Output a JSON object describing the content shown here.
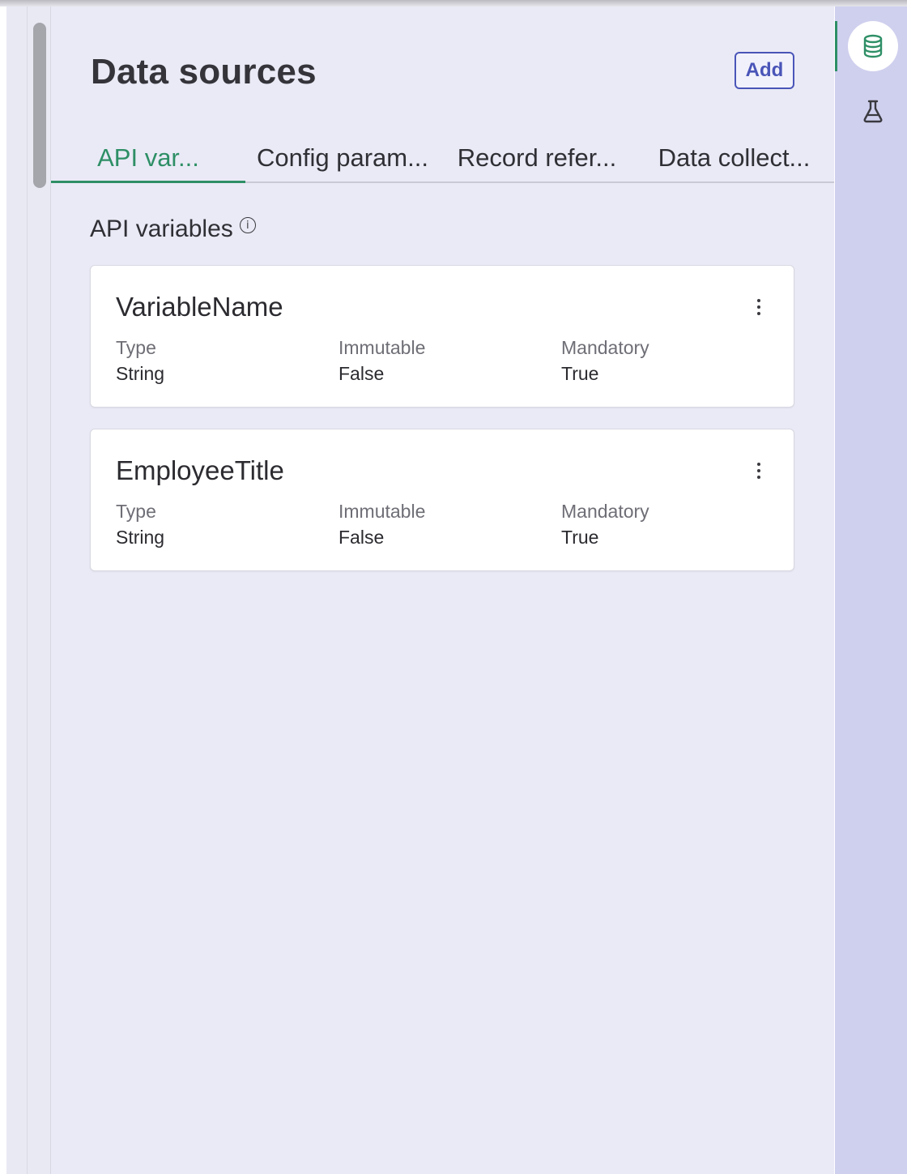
{
  "panel": {
    "title": "Data sources",
    "add_label": "Add"
  },
  "tabs": [
    {
      "label": "API var...",
      "active": true
    },
    {
      "label": "Config param...",
      "active": false
    },
    {
      "label": "Record refer...",
      "active": false
    },
    {
      "label": "Data collect...",
      "active": false
    }
  ],
  "section": {
    "heading": "API variables",
    "info_icon": "info-icon"
  },
  "variables": [
    {
      "name": "VariableName",
      "fields": [
        {
          "label": "Type",
          "value": "String"
        },
        {
          "label": "Immutable",
          "value": "False"
        },
        {
          "label": "Mandatory",
          "value": "True"
        }
      ]
    },
    {
      "name": "EmployeeTitle",
      "fields": [
        {
          "label": "Type",
          "value": "String"
        },
        {
          "label": "Immutable",
          "value": "False"
        },
        {
          "label": "Mandatory",
          "value": "True"
        }
      ]
    }
  ],
  "rail": {
    "items": [
      {
        "icon": "database-icon",
        "active": true
      },
      {
        "icon": "flask-icon",
        "active": false
      }
    ]
  },
  "colors": {
    "accent_green": "#2e8f66",
    "button_blue": "#4a55b8",
    "panel_bg": "#eaeaf6",
    "rail_bg": "#cfcfee"
  }
}
